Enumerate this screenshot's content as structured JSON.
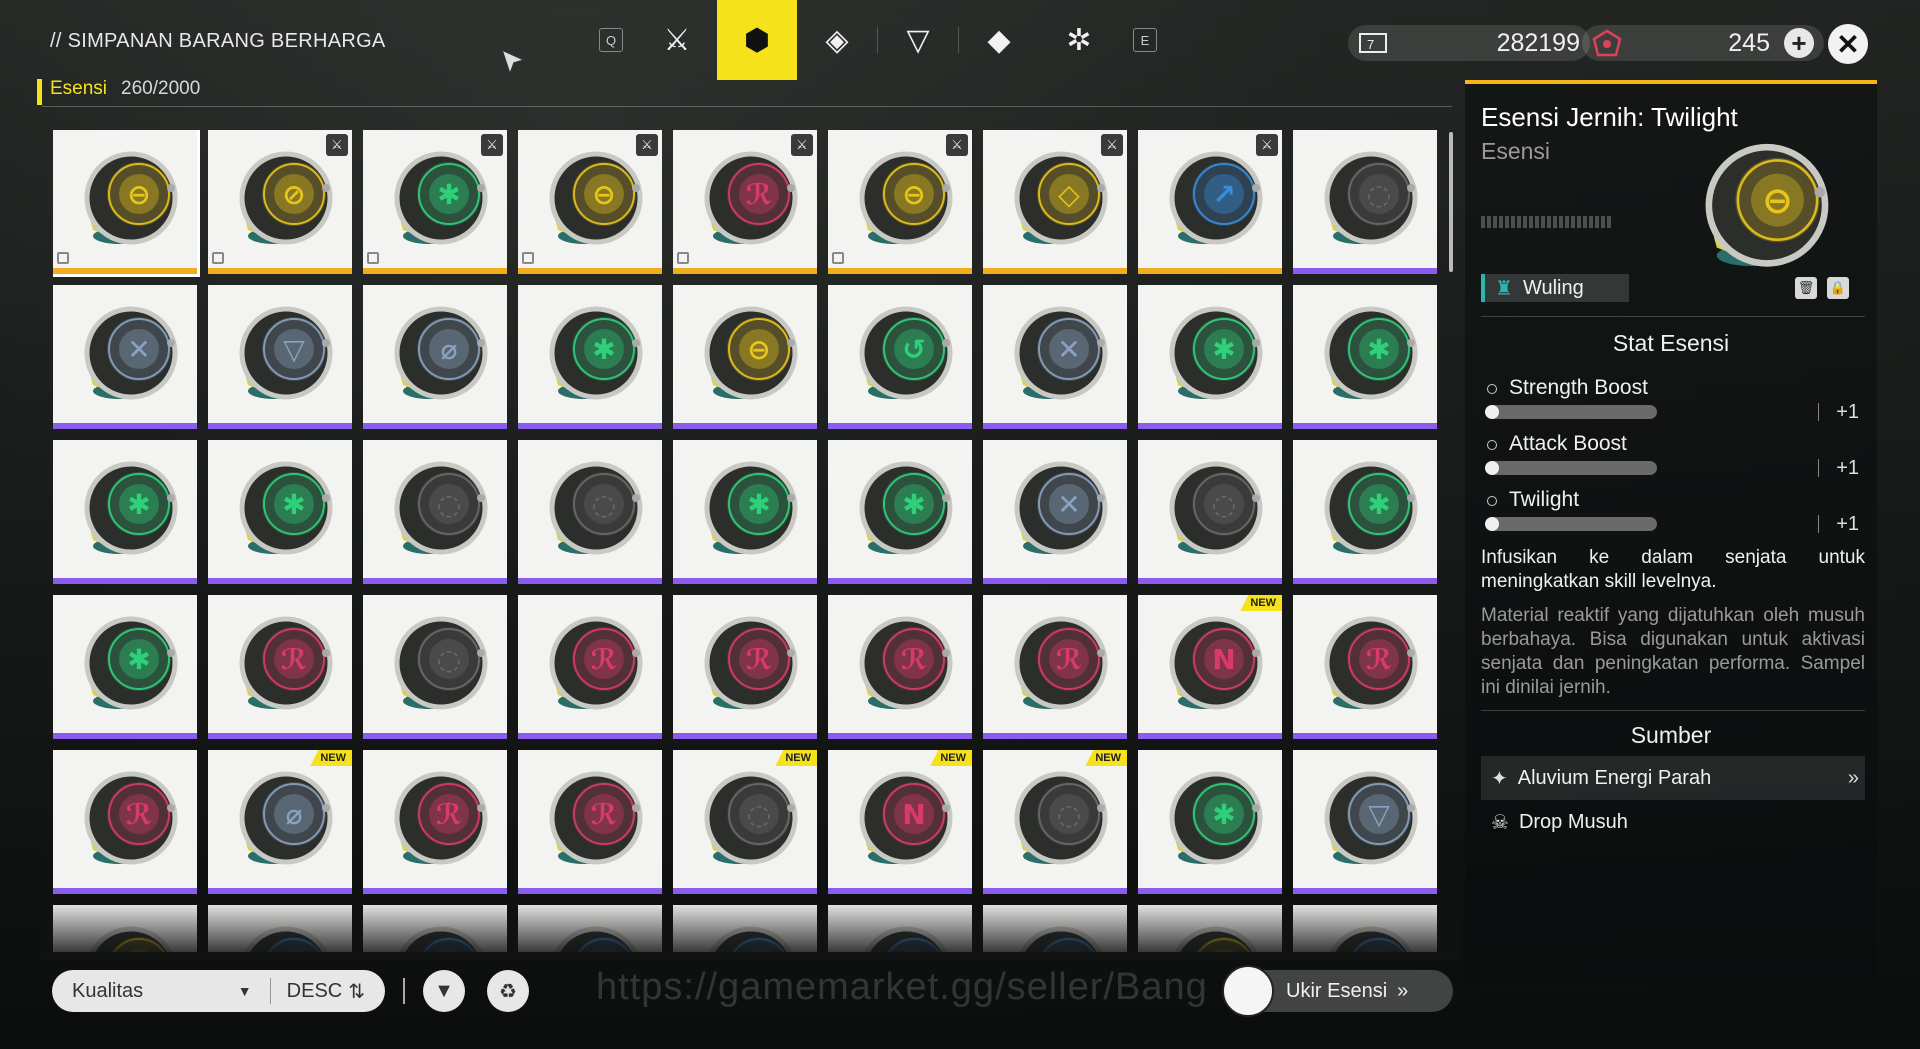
{
  "header": {
    "title": "// SIMPANAN BARANG BERHARGA",
    "subtab_label": "Esensi",
    "subtab_count": "260/2000",
    "tab_key_left": "Q",
    "tab_key_right": "E",
    "tabs": [
      {
        "icon": "slashed-sword-icon",
        "glyph": "⚔"
      },
      {
        "icon": "cube-icon",
        "glyph": "⬢",
        "active": true
      },
      {
        "icon": "diamond-arrow-icon",
        "glyph": "◈"
      },
      {
        "icon": "triangle-icon",
        "glyph": "▽"
      },
      {
        "icon": "tag-icon",
        "glyph": "◆"
      },
      {
        "icon": "gear-cog-icon",
        "glyph": "✲"
      }
    ],
    "currency1": "282199",
    "currency2": "245"
  },
  "colors": {
    "accent": "#f6e21b",
    "rarity_gold": "#f1ad1e",
    "rarity_purple": "#8a5cf0"
  },
  "grid": [
    {
      "color": "#e8c51a",
      "glyph": "⊖",
      "rarity": "gold",
      "lock": true,
      "selected": true
    },
    {
      "color": "#e8c51a",
      "glyph": "⊘",
      "rarity": "gold",
      "lock": true,
      "sword": true
    },
    {
      "color": "#2fd07a",
      "glyph": "✱",
      "rarity": "gold",
      "lock": true,
      "sword": true
    },
    {
      "color": "#e8c51a",
      "glyph": "⊖",
      "rarity": "gold",
      "lock": true,
      "sword": true
    },
    {
      "color": "#d83b6a",
      "glyph": "ℛ",
      "rarity": "gold",
      "lock": true,
      "sword": true
    },
    {
      "color": "#e8c51a",
      "glyph": "⊖",
      "rarity": "gold",
      "lock": true,
      "sword": true
    },
    {
      "color": "#e8c51a",
      "glyph": "◇",
      "rarity": "gold",
      "sword": true
    },
    {
      "color": "#3a8ee0",
      "glyph": "↗",
      "rarity": "gold",
      "sword": true
    },
    {
      "color": "#6a6a6a",
      "glyph": "◌",
      "rarity": "purple"
    },
    {
      "color": "#8aa2c0",
      "glyph": "✕",
      "rarity": "purple"
    },
    {
      "color": "#8aa2c0",
      "glyph": "▽",
      "rarity": "purple"
    },
    {
      "color": "#8aa2c0",
      "glyph": "⌀",
      "rarity": "purple"
    },
    {
      "color": "#2fd07a",
      "glyph": "✱",
      "rarity": "purple"
    },
    {
      "color": "#e8c51a",
      "glyph": "⊖",
      "rarity": "purple"
    },
    {
      "color": "#2fd07a",
      "glyph": "↺",
      "rarity": "purple"
    },
    {
      "color": "#8aa2c0",
      "glyph": "✕",
      "rarity": "purple"
    },
    {
      "color": "#2fd07a",
      "glyph": "✱",
      "rarity": "purple"
    },
    {
      "color": "#2fd07a",
      "glyph": "✱",
      "rarity": "purple"
    },
    {
      "color": "#2fd07a",
      "glyph": "✱",
      "rarity": "purple"
    },
    {
      "color": "#2fd07a",
      "glyph": "✱",
      "rarity": "purple"
    },
    {
      "color": "#6a6a6a",
      "glyph": "◌",
      "rarity": "purple"
    },
    {
      "color": "#6a6a6a",
      "glyph": "◌",
      "rarity": "purple"
    },
    {
      "color": "#2fd07a",
      "glyph": "✱",
      "rarity": "purple"
    },
    {
      "color": "#2fd07a",
      "glyph": "✱",
      "rarity": "purple"
    },
    {
      "color": "#8aa2c0",
      "glyph": "✕",
      "rarity": "purple"
    },
    {
      "color": "#6a6a6a",
      "glyph": "◌",
      "rarity": "purple"
    },
    {
      "color": "#2fd07a",
      "glyph": "✱",
      "rarity": "purple"
    },
    {
      "color": "#2fd07a",
      "glyph": "✱",
      "rarity": "purple"
    },
    {
      "color": "#d83b6a",
      "glyph": "ℛ",
      "rarity": "purple"
    },
    {
      "color": "#6a6a6a",
      "glyph": "◌",
      "rarity": "purple"
    },
    {
      "color": "#d83b6a",
      "glyph": "ℛ",
      "rarity": "purple"
    },
    {
      "color": "#d83b6a",
      "glyph": "ℛ",
      "rarity": "purple"
    },
    {
      "color": "#d83b6a",
      "glyph": "ℛ",
      "rarity": "purple"
    },
    {
      "color": "#d83b6a",
      "glyph": "ℛ",
      "rarity": "purple"
    },
    {
      "color": "#d83b6a",
      "glyph": "N",
      "rarity": "purple",
      "new": true
    },
    {
      "color": "#d83b6a",
      "glyph": "ℛ",
      "rarity": "purple"
    },
    {
      "color": "#d83b6a",
      "glyph": "ℛ",
      "rarity": "purple"
    },
    {
      "color": "#8aa2c0",
      "glyph": "⌀",
      "rarity": "purple",
      "new": true
    },
    {
      "color": "#d83b6a",
      "glyph": "ℛ",
      "rarity": "purple"
    },
    {
      "color": "#d83b6a",
      "glyph": "ℛ",
      "rarity": "purple"
    },
    {
      "color": "#6a6a6a",
      "glyph": "◌",
      "rarity": "purple",
      "new": true
    },
    {
      "color": "#d83b6a",
      "glyph": "N",
      "rarity": "purple",
      "new": true
    },
    {
      "color": "#6a6a6a",
      "glyph": "◌",
      "rarity": "purple",
      "new": true
    },
    {
      "color": "#2fd07a",
      "glyph": "✱",
      "rarity": "purple"
    },
    {
      "color": "#8aa2c0",
      "glyph": "▽",
      "rarity": "purple"
    },
    {
      "color": "#e8c51a",
      "glyph": "",
      "rarity": "purple"
    },
    {
      "color": "#3a8ee0",
      "glyph": "",
      "rarity": "purple"
    },
    {
      "color": "#3a8ee0",
      "glyph": "",
      "rarity": "purple"
    },
    {
      "color": "#3a8ee0",
      "glyph": "",
      "rarity": "purple"
    },
    {
      "color": "#3a8ee0",
      "glyph": "",
      "rarity": "purple"
    },
    {
      "color": "#3a8ee0",
      "glyph": "",
      "rarity": "purple"
    },
    {
      "color": "#3a8ee0",
      "glyph": "",
      "rarity": "purple"
    },
    {
      "color": "#e8c51a",
      "glyph": "",
      "rarity": "purple"
    },
    {
      "color": "#3a8ee0",
      "glyph": "",
      "rarity": "purple"
    }
  ],
  "new_label": "NEW",
  "detail": {
    "title": "Esensi Jernih: Twilight",
    "subtitle": "Esensi",
    "orb_color": "#e8c51a",
    "orb_glyph": "⊖",
    "tag": "Wuling",
    "stats_heading": "Stat Esensi",
    "stats": [
      {
        "name": "Strength Boost",
        "value": "+1",
        "level": 0.05
      },
      {
        "name": "Attack Boost",
        "value": "+1",
        "level": 0.05
      },
      {
        "name": "Twilight",
        "value": "+1",
        "level": 0.05
      }
    ],
    "description": "Infusikan ke dalam senjata untuk meningkatkan skill levelnya.",
    "lore": "Material reaktif yang dijatuhkan oleh musuh berbahaya. Bisa digunakan untuk aktivasi senjata dan peningkatan performa. Sampel ini dinilai jernih.",
    "source_heading": "Sumber",
    "sources": [
      "Aluvium Energi Parah",
      "Drop Musuh"
    ]
  },
  "bottom": {
    "sort_label": "Kualitas",
    "order_label": "DESC",
    "watermark": "https://gamemarket.gg/seller/Bang",
    "ukir_label": "Ukir Esensi"
  }
}
